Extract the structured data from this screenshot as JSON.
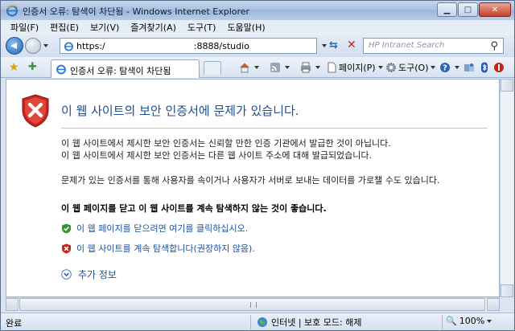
{
  "window": {
    "title": "인증서 오류: 탐색이 차단됨 - Windows Internet Explorer",
    "buttons": {
      "minimize": "▁",
      "maximize": "□",
      "close": "✕"
    }
  },
  "menubar": {
    "items": [
      {
        "label": "파일(F)"
      },
      {
        "label": "편집(E)"
      },
      {
        "label": "보기(V)"
      },
      {
        "label": "즐겨찾기(A)"
      },
      {
        "label": "도구(T)"
      },
      {
        "label": "도움말(H)"
      }
    ]
  },
  "address": {
    "url_prefix": "https:/",
    "url_suffix": ":8888/studio",
    "search_placeholder": "HP Intranet Search"
  },
  "tabs": {
    "active_label": "인증서 오류: 탐색이 차단됨"
  },
  "commandbar": {
    "page_label": "페이지(P)",
    "tools_label": "도구(O)"
  },
  "content": {
    "heading": "이 웹 사이트의 보안 인증서에 문제가 있습니다.",
    "para1_line1": "이 웹 사이트에서 제시한 보안 인증서는 신뢰할 만한 인증 기관에서 발급한 것이 아닙니다.",
    "para1_line2": "이 웹 사이트에서 제시한 보안 인증서는 다른 웹 사이트 주소에 대해 발급되었습니다.",
    "para2": "문제가 있는 인증서를 통해 사용자를 속이거나 사용자가 서버로 보내는 데이터를 가로챌 수도 있습니다.",
    "recommendation": "이 웹 페이지를 닫고 이 웹 사이트를 계속 탐색하지 않는 것이 좋습니다.",
    "option_close": "이 웹 페이지를 닫으려면 여기를 클릭하십시오.",
    "option_continue": "이 웹 사이트를 계속 탐색합니다(권장하지 않음).",
    "more_info": "추가 정보"
  },
  "statusbar": {
    "status": "완료",
    "zone": "인터넷 | 보호 모드: 해제",
    "zoom": "100%"
  },
  "colors": {
    "heading": "#1f4f8c",
    "link": "#1a53a6",
    "error_red": "#c8231a",
    "ok_green": "#2e9a2e"
  }
}
